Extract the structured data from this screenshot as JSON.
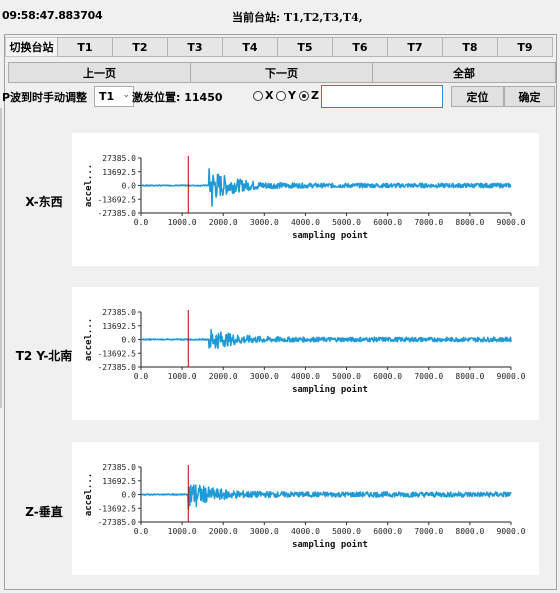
{
  "header": {
    "time": "09:58:47.883704",
    "current_stations": "当前台站: T1,T2,T3,T4,"
  },
  "tabs": {
    "switch_label": "切换台站",
    "items": [
      "T1",
      "T2",
      "T3",
      "T4",
      "T5",
      "T6",
      "T7",
      "T8",
      "T9"
    ]
  },
  "pager": {
    "prev": "上一页",
    "next": "下一页",
    "all": "全部"
  },
  "controls": {
    "p_wave_label": "P波到时手动调整",
    "station_select": "T1",
    "trigger_label": "激发位置: 11450",
    "radios": [
      {
        "label": "X",
        "checked": false
      },
      {
        "label": "Y",
        "checked": false
      },
      {
        "label": "Z",
        "checked": true
      }
    ],
    "position_value": "",
    "locate_button": "定位",
    "confirm_button": "确定"
  },
  "channels": [
    {
      "label": "X-东西"
    },
    {
      "label": "T2 Y-北南"
    },
    {
      "label": "Z-垂直"
    }
  ],
  "colors": {
    "waveform": "#1f9ad6",
    "marker": "#c00000"
  },
  "chart_data": [
    {
      "type": "line",
      "title": "",
      "xlabel": "sampling point",
      "ylabel": "accel...",
      "xlim": [
        0,
        9000
      ],
      "ylim": [
        -27385.0,
        27385.0
      ],
      "x_ticks": [
        "0.0",
        "1000.0",
        "2000.0",
        "3000.0",
        "4000.0",
        "5000.0",
        "6000.0",
        "7000.0",
        "8000.0",
        "9000.0"
      ],
      "y_ticks": [
        "27385.0",
        "13692.5",
        "0.0",
        "-13692.5",
        "-27385.0"
      ],
      "marker_x": 1150,
      "series": [
        {
          "onset": 1650,
          "peak_x": 1720,
          "peak": 27000,
          "early_amp": 16000,
          "late_amp": 2200
        }
      ]
    },
    {
      "type": "line",
      "title": "",
      "xlabel": "sampling point",
      "ylabel": "accel...",
      "xlim": [
        0,
        9000
      ],
      "ylim": [
        -27385.0,
        27385.0
      ],
      "x_ticks": [
        "0.0",
        "1000.0",
        "2000.0",
        "3000.0",
        "4000.0",
        "5000.0",
        "6000.0",
        "7000.0",
        "8000.0",
        "9000.0"
      ],
      "y_ticks": [
        "27385.0",
        "13692.5",
        "0.0",
        "-13692.5",
        "-27385.0"
      ],
      "marker_x": 1150,
      "series": [
        {
          "onset": 1650,
          "peak_x": 1850,
          "peak": 13500,
          "early_amp": 10000,
          "late_amp": 2200
        }
      ]
    },
    {
      "type": "line",
      "title": "",
      "xlabel": "sampling point",
      "ylabel": "accel...",
      "xlim": [
        0,
        9000
      ],
      "ylim": [
        -27385.0,
        27385.0
      ],
      "x_ticks": [
        "0.0",
        "1000.0",
        "2000.0",
        "3000.0",
        "4000.0",
        "5000.0",
        "6000.0",
        "7000.0",
        "8000.0",
        "9000.0"
      ],
      "y_ticks": [
        "27385.0",
        "13692.5",
        "0.0",
        "-13692.5",
        "-27385.0"
      ],
      "marker_x": 1150,
      "series": [
        {
          "onset": 1150,
          "peak_x": 1350,
          "peak": 16500,
          "early_amp": 12000,
          "late_amp": 2600
        }
      ]
    }
  ]
}
